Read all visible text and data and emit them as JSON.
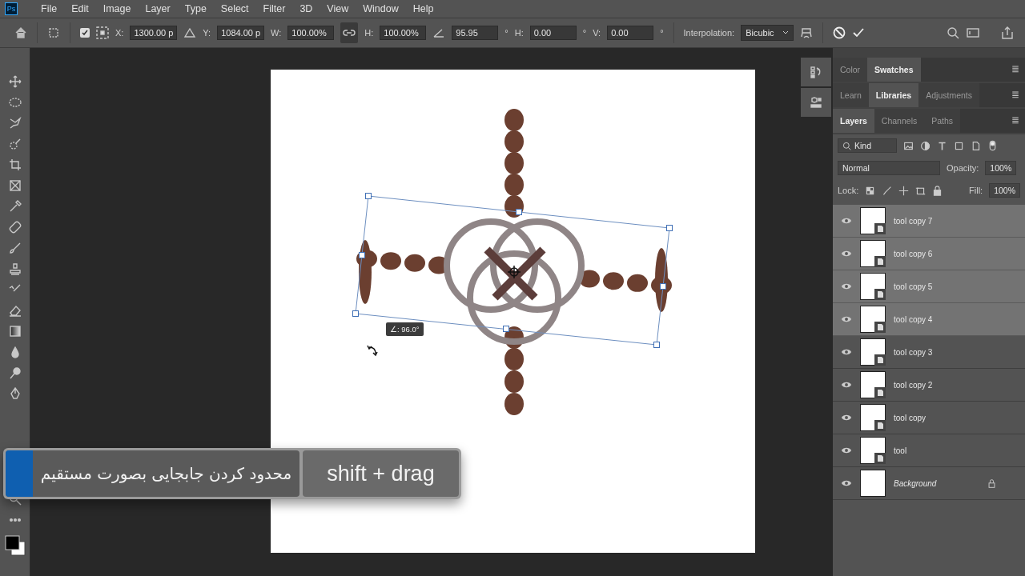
{
  "menu_bar": {
    "app_badge": "Ps",
    "items": [
      "File",
      "Edit",
      "Image",
      "Layer",
      "Type",
      "Select",
      "Filter",
      "3D",
      "View",
      "Window",
      "Help"
    ]
  },
  "options_bar": {
    "reference_point_checked": true,
    "fields": [
      {
        "label": "X:",
        "value": "1300.00 p"
      },
      {
        "label": "Y:",
        "value": "1084.00 p"
      },
      {
        "label": "W:",
        "value": "100.00%"
      },
      {
        "label": "H:",
        "value": "100.00%"
      },
      {
        "value": "95.95",
        "unit": "°"
      },
      {
        "label": "H:",
        "value": "0.00",
        "unit": "°"
      },
      {
        "label": "V:",
        "value": "0.00",
        "unit": "°"
      }
    ],
    "link_on": true,
    "interpolation_label": "Interpolation:",
    "interpolation": "Bicubic"
  },
  "canvas": {
    "angle_readout": "∠: 96.0°"
  },
  "caption": {
    "description": "محدود کردن جابجایی بصورت مستقیم",
    "shortcut": "shift + drag"
  },
  "panel_groups": [
    {
      "tabs": [
        {
          "label": "Color",
          "selected": false
        },
        {
          "label": "Swatches",
          "selected": true
        }
      ]
    },
    {
      "tabs": [
        {
          "label": "Learn",
          "selected": false
        },
        {
          "label": "Libraries",
          "selected": true
        },
        {
          "label": "Adjustments",
          "selected": false
        }
      ]
    },
    {
      "tabs": [
        {
          "label": "Layers",
          "selected": true
        },
        {
          "label": "Channels",
          "selected": false
        },
        {
          "label": "Paths",
          "selected": false
        }
      ]
    }
  ],
  "layers_panel": {
    "filter": "Kind",
    "blend_mode": "Normal",
    "opacity_label": "Opacity:",
    "opacity": "100%",
    "lock_label": "Lock:",
    "fill_label": "Fill:",
    "fill": "100%",
    "layers": [
      {
        "name": "tool copy 7",
        "selected": true,
        "visible": true,
        "kind": "smart"
      },
      {
        "name": "tool copy 6",
        "selected": true,
        "visible": true,
        "kind": "smart"
      },
      {
        "name": "tool copy 5",
        "selected": true,
        "visible": true,
        "kind": "smart"
      },
      {
        "name": "tool copy 4",
        "selected": true,
        "visible": true,
        "kind": "smart"
      },
      {
        "name": "tool copy 3",
        "selected": false,
        "visible": true,
        "kind": "smart"
      },
      {
        "name": "tool copy 2",
        "selected": false,
        "visible": true,
        "kind": "smart"
      },
      {
        "name": "tool copy",
        "selected": false,
        "visible": true,
        "kind": "smart"
      },
      {
        "name": "tool",
        "selected": false,
        "visible": true,
        "kind": "smart"
      },
      {
        "name": "Background",
        "selected": false,
        "visible": true,
        "kind": "background"
      }
    ]
  }
}
